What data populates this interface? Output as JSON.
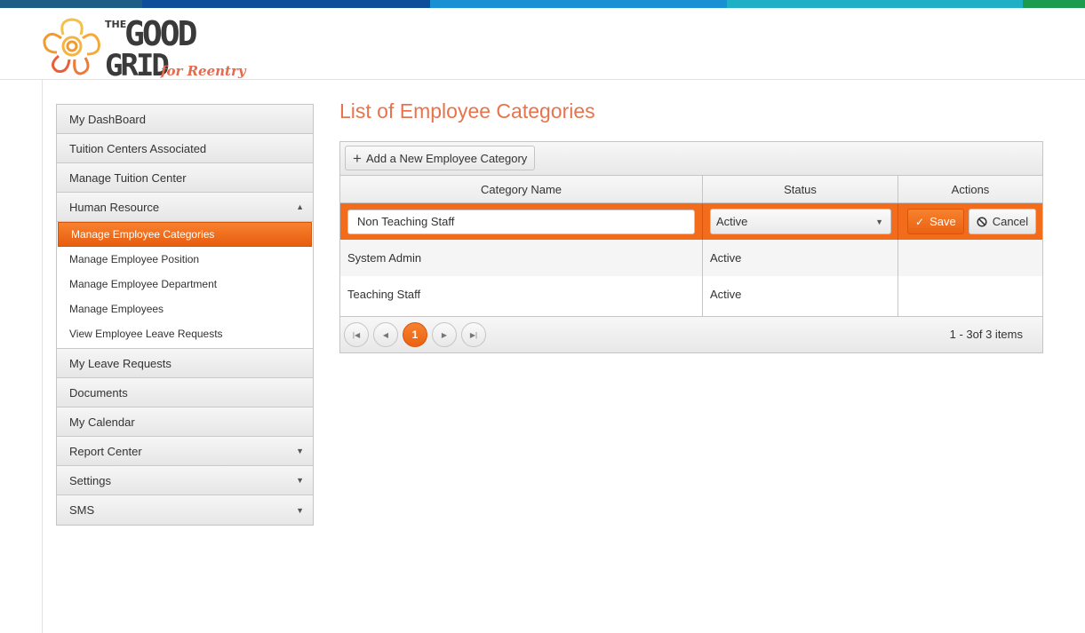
{
  "colors": {
    "accent": "#f26c1c",
    "title": "#e8744d",
    "topbar": [
      "#1d5e86",
      "#0f4e9a",
      "#1a90d4",
      "#1fb0c6",
      "#1a9b4e"
    ]
  },
  "brand": {
    "the": "THE",
    "good": "GOOD",
    "grid": "GRID",
    "tagline": "for Reentry"
  },
  "sidebar": {
    "items": [
      {
        "label": "My DashBoard"
      },
      {
        "label": "Tuition Centers Associated"
      },
      {
        "label": "Manage Tuition Center"
      },
      {
        "label": "Human Resource",
        "arrow": "▲"
      },
      {
        "label": "My Leave Requests"
      },
      {
        "label": "Documents"
      },
      {
        "label": "My Calendar"
      },
      {
        "label": "Report Center",
        "arrow": "▼"
      },
      {
        "label": "Settings",
        "arrow": "▼"
      },
      {
        "label": "SMS",
        "arrow": "▼"
      }
    ],
    "sub_items": [
      {
        "label": "Manage Employee Categories"
      },
      {
        "label": "Manage Employee Position"
      },
      {
        "label": "Manage Employee Department"
      },
      {
        "label": "Manage Employees"
      },
      {
        "label": "View Employee Leave Requests"
      }
    ]
  },
  "main": {
    "title": "List of Employee Categories",
    "add_label": "Add a New Employee Category",
    "columns": [
      "Category Name",
      "Status",
      "Actions"
    ],
    "edit_row": {
      "name_value": "Non Teaching Staff",
      "status_value": "Active",
      "save_label": "Save",
      "cancel_label": "Cancel"
    },
    "rows": [
      {
        "name": "System Admin",
        "status": "Active"
      },
      {
        "name": "Teaching Staff",
        "status": "Active"
      }
    ],
    "pager": {
      "current_page": "1",
      "info": "1 - 3of 3 items"
    }
  }
}
